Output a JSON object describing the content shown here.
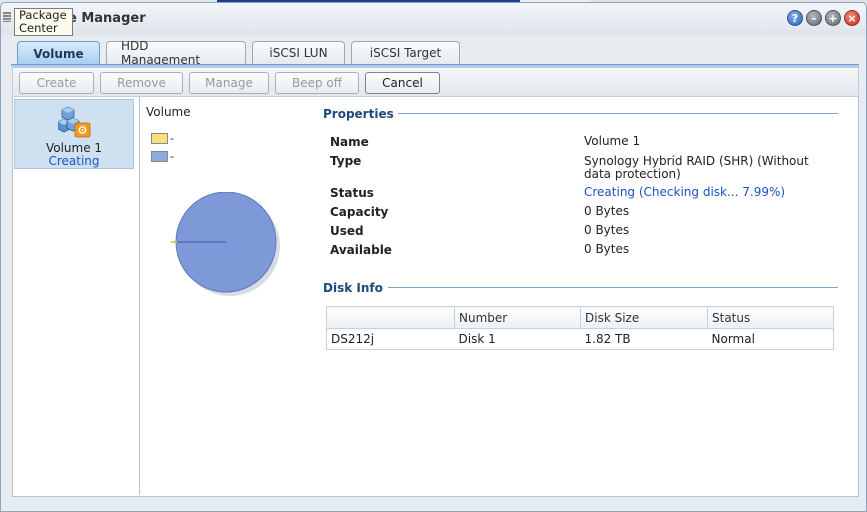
{
  "window": {
    "title": "Storage Manager",
    "title_visible_suffix": "e Manager"
  },
  "tooltip": {
    "text": "Package Center"
  },
  "tabs": [
    {
      "label": "Volume",
      "active": true
    },
    {
      "label": "HDD Management",
      "active": false
    },
    {
      "label": "iSCSI LUN",
      "active": false
    },
    {
      "label": "iSCSI Target",
      "active": false
    }
  ],
  "toolbar": {
    "create_label": "Create",
    "remove_label": "Remove",
    "manage_label": "Manage",
    "beep_off_label": "Beep off",
    "cancel_label": "Cancel"
  },
  "volume_list": [
    {
      "name": "Volume 1",
      "state": "Creating",
      "icon": "volume-icon"
    }
  ],
  "chart": {
    "title": "Volume",
    "legend": [
      {
        "label": "-",
        "color": "#f5e27a"
      },
      {
        "label": "-",
        "color": "#8faadc"
      }
    ]
  },
  "chart_data": {
    "type": "pie",
    "title": "Volume",
    "series": [
      {
        "label": "-",
        "value": 0,
        "color": "#f5e27a"
      },
      {
        "label": "-",
        "value": 100,
        "color": "#7e99d8"
      }
    ]
  },
  "properties": {
    "section_title": "Properties",
    "rows": [
      {
        "label": "Name",
        "value": "Volume 1"
      },
      {
        "label": "Type",
        "value": "Synology Hybrid RAID (SHR) (Without data protection)"
      },
      {
        "label": "Status",
        "value_prefix": "Creating",
        "value_suffix": "(Checking disk... 7.99%)"
      },
      {
        "label": "Capacity",
        "value": "0 Bytes"
      },
      {
        "label": "Used",
        "value": "0 Bytes"
      },
      {
        "label": "Available",
        "value": "0 Bytes"
      }
    ]
  },
  "disk_info": {
    "section_title": "Disk Info",
    "columns": [
      "",
      "Number",
      "Disk Size",
      "Status"
    ],
    "rows": [
      {
        "device": "DS212j",
        "number": "Disk 1",
        "size": "1.82 TB",
        "status": "Normal"
      }
    ]
  }
}
